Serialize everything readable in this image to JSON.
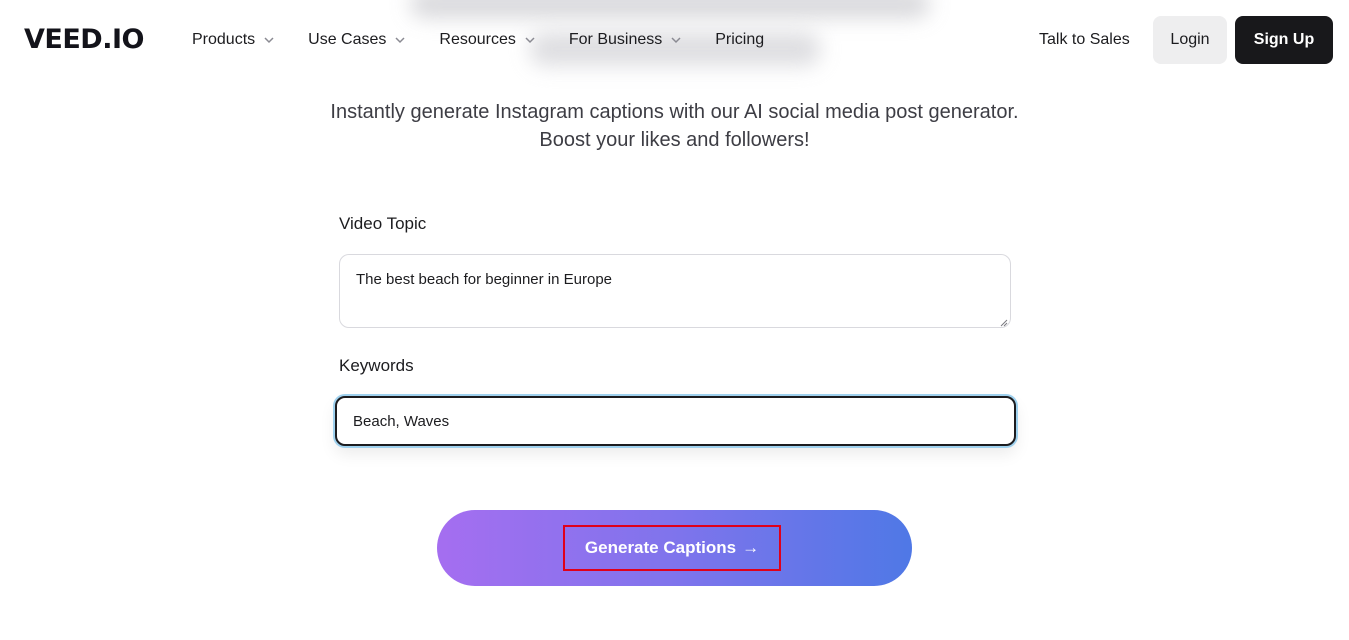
{
  "header": {
    "logo": "VEED.IO",
    "nav": [
      {
        "label": "Products",
        "has_dropdown": true
      },
      {
        "label": "Use Cases",
        "has_dropdown": true
      },
      {
        "label": "Resources",
        "has_dropdown": true
      },
      {
        "label": "For Business",
        "has_dropdown": true
      },
      {
        "label": "Pricing",
        "has_dropdown": false
      }
    ],
    "talk_to_sales": "Talk to Sales",
    "login": "Login",
    "signup": "Sign Up"
  },
  "subtitle": {
    "line1": "Instantly generate Instagram captions with our AI social media post generator.",
    "line2": "Boost your likes and followers!"
  },
  "form": {
    "topic_label": "Video Topic",
    "topic_value": "The best beach for beginner in Europe",
    "keywords_label": "Keywords",
    "keywords_value": "Beach, Waves",
    "generate_label": "Generate Captions",
    "generate_icon": "arrow-right-icon"
  },
  "colors": {
    "primary_dark": "#18181b",
    "gradient_start": "#a56ef0",
    "gradient_end": "#4f78e6",
    "highlight_box": "#e0001a",
    "focus_ring": "#9fd1ee"
  }
}
